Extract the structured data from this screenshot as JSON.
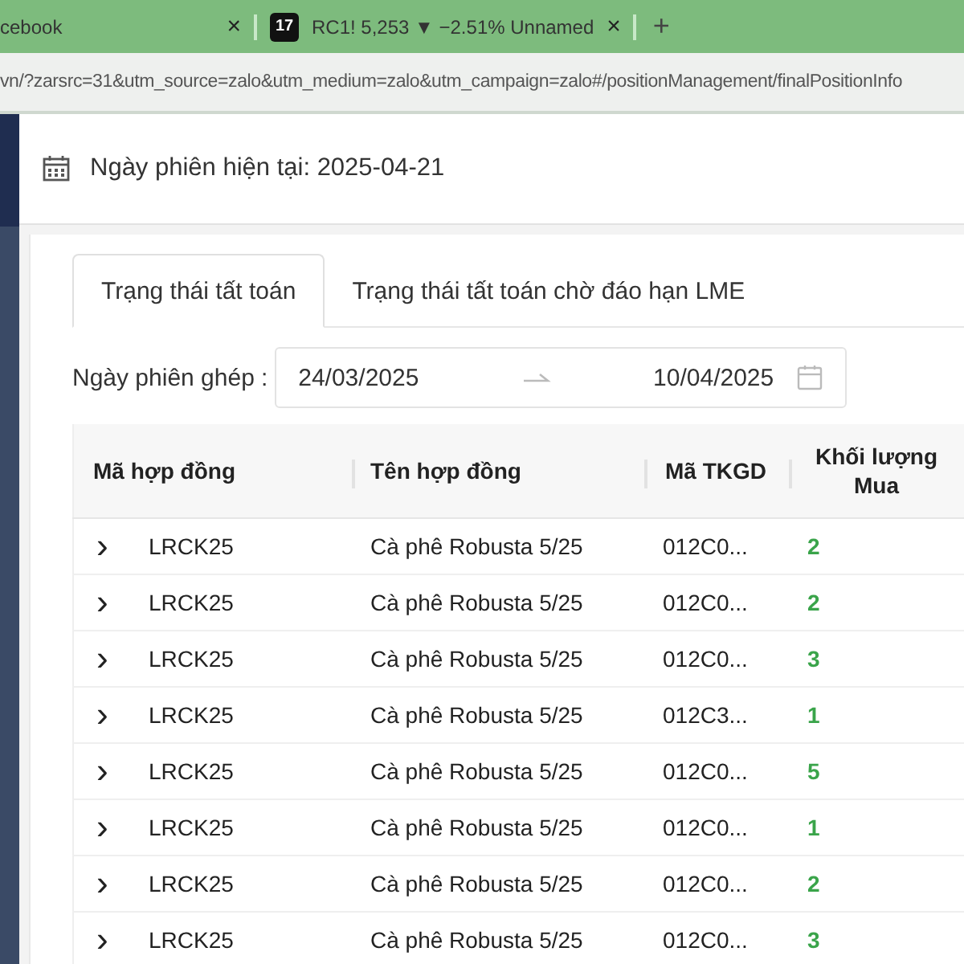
{
  "browser": {
    "tabs": [
      {
        "title": "cebook"
      },
      {
        "title": "RC1! 5,253 ▼ −2.51% Unnamed",
        "logo_text": "17"
      }
    ],
    "close_glyph": "×",
    "new_tab_glyph": "+",
    "url": "vn/?zarsrc=31&utm_source=zalo&utm_medium=zalo&utm_campaign=zalo#/positionManagement/finalPositionInfo"
  },
  "header": {
    "session_date": "Ngày phiên hiện tại: 2025-04-21"
  },
  "tabs": [
    {
      "label": "Trạng thái tất toán",
      "selected": true
    },
    {
      "label": "Trạng thái tất toán chờ đáo hạn LME",
      "selected": false
    }
  ],
  "filter": {
    "label": "Ngày phiên ghép",
    "colon": ":",
    "start": "24/03/2025",
    "end": "10/04/2025"
  },
  "table": {
    "columns": [
      "Mã hợp đồng",
      "Tên hợp đồng",
      "Mã TKGD",
      "Khối lượng Mua"
    ],
    "rows": [
      {
        "expand": "›",
        "code": "LRCK25",
        "name": "Cà phê Robusta 5/25",
        "account": "012C0...",
        "buy_volume": "2",
        "expanded": false
      },
      {
        "expand": "›",
        "code": "LRCK25",
        "name": "Cà phê Robusta 5/25",
        "account": "012C0...",
        "buy_volume": "2",
        "expanded": false
      },
      {
        "expand": "›",
        "code": "LRCK25",
        "name": "Cà phê Robusta 5/25",
        "account": "012C0...",
        "buy_volume": "3",
        "expanded": false
      },
      {
        "expand": "›",
        "code": "LRCK25",
        "name": "Cà phê Robusta 5/25",
        "account": "012C3...",
        "buy_volume": "1",
        "expanded": false
      },
      {
        "expand": "›",
        "code": "LRCK25",
        "name": "Cà phê Robusta 5/25",
        "account": "012C0...",
        "buy_volume": "5",
        "expanded": false
      },
      {
        "expand": "›",
        "code": "LRCK25",
        "name": "Cà phê Robusta 5/25",
        "account": "012C0...",
        "buy_volume": "1",
        "expanded": false
      },
      {
        "expand": "›",
        "code": "LRCK25",
        "name": "Cà phê Robusta 5/25",
        "account": "012C0...",
        "buy_volume": "2",
        "expanded": false
      },
      {
        "expand": "›",
        "code": "LRCK25",
        "name": "Cà phê Robusta 5/25",
        "account": "012C0...",
        "buy_volume": "3",
        "expanded": false
      }
    ]
  }
}
